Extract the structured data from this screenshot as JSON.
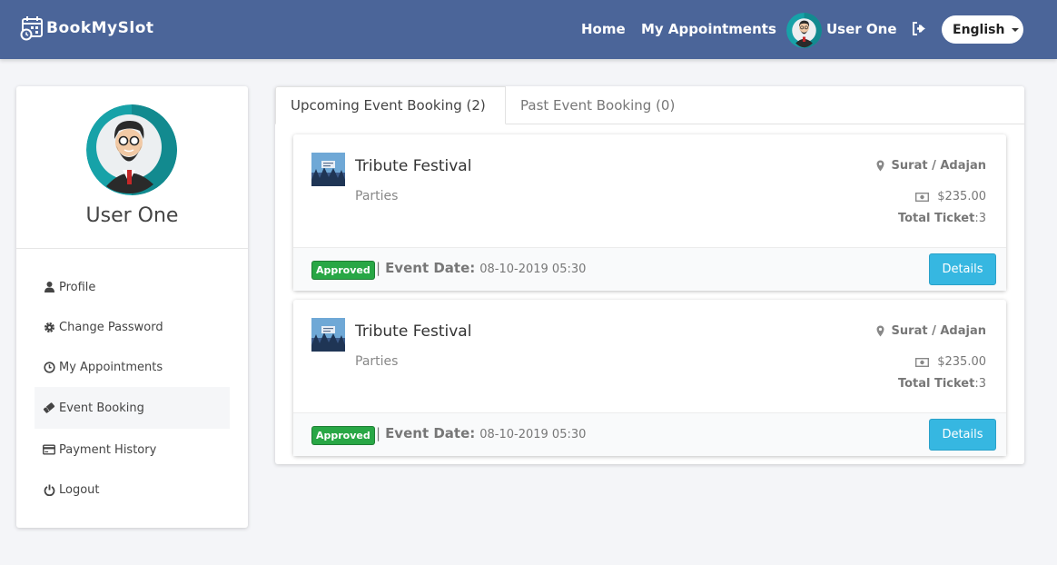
{
  "header": {
    "brand": "BookMySlot",
    "nav_home": "Home",
    "nav_appointments": "My Appointments",
    "user_name": "User One",
    "language": "English",
    "bg_color": "#4b6599"
  },
  "sidebar": {
    "user_name": "User One",
    "items": [
      {
        "label": "Profile",
        "icon": "user-icon"
      },
      {
        "label": "Change Password",
        "icon": "gear-icon"
      },
      {
        "label": "My Appointments",
        "icon": "clock-icon"
      },
      {
        "label": "Event Booking",
        "icon": "ticket-icon",
        "active": true
      },
      {
        "label": "Payment History",
        "icon": "credit-card-icon"
      },
      {
        "label": "Logout",
        "icon": "power-icon"
      }
    ]
  },
  "tabs": {
    "upcoming": "Upcoming Event Booking (2)",
    "past": "Past Event Booking (0)"
  },
  "bookings": [
    {
      "title": "Tribute Festival",
      "category": "Parties",
      "location": "Surat / Adajan",
      "price": "$235.00",
      "tickets_label": "Total Ticket",
      "tickets_value": ":3",
      "status": "Approved",
      "separator": "|",
      "date_label": "Event Date:",
      "date_value": "08-10-2019 05:30",
      "button": "Details"
    },
    {
      "title": "Tribute Festival",
      "category": "Parties",
      "location": "Surat / Adajan",
      "price": "$235.00",
      "tickets_label": "Total Ticket",
      "tickets_value": ":3",
      "status": "Approved",
      "separator": "|",
      "date_label": "Event Date:",
      "date_value": "08-10-2019 05:30",
      "button": "Details"
    }
  ]
}
